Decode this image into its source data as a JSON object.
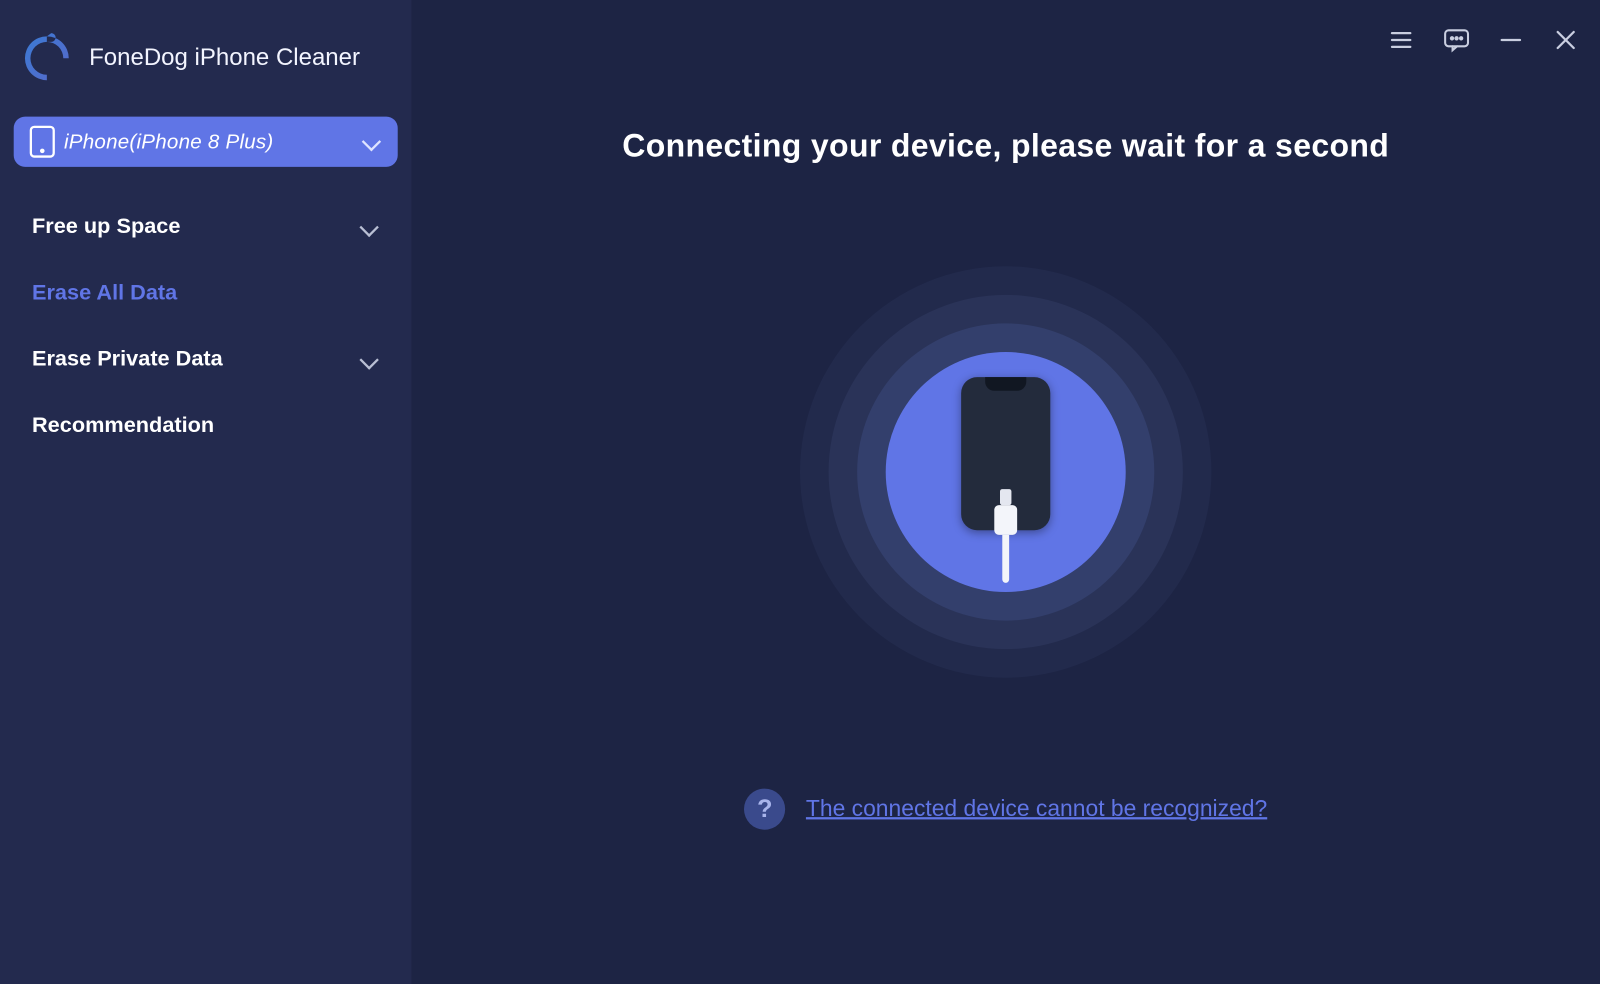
{
  "app": {
    "title": "FoneDog iPhone Cleaner"
  },
  "device": {
    "label": "iPhone(iPhone 8 Plus)"
  },
  "sidebar": {
    "items": [
      {
        "label": "Free up Space",
        "expandable": true,
        "active": false
      },
      {
        "label": "Erase All Data",
        "expandable": false,
        "active": true
      },
      {
        "label": "Erase Private Data",
        "expandable": true,
        "active": false
      },
      {
        "label": "Recommendation",
        "expandable": false,
        "active": false
      }
    ]
  },
  "main": {
    "status_title": "Connecting your device, please wait for a second",
    "help_link": "The connected device cannot be recognized?"
  },
  "titlebar": {
    "menu": "menu",
    "feedback": "feedback",
    "minimize": "minimize",
    "close": "close"
  },
  "colors": {
    "bg": "#1d2444",
    "sidebar": "#232a4e",
    "accent": "#6075e6"
  }
}
